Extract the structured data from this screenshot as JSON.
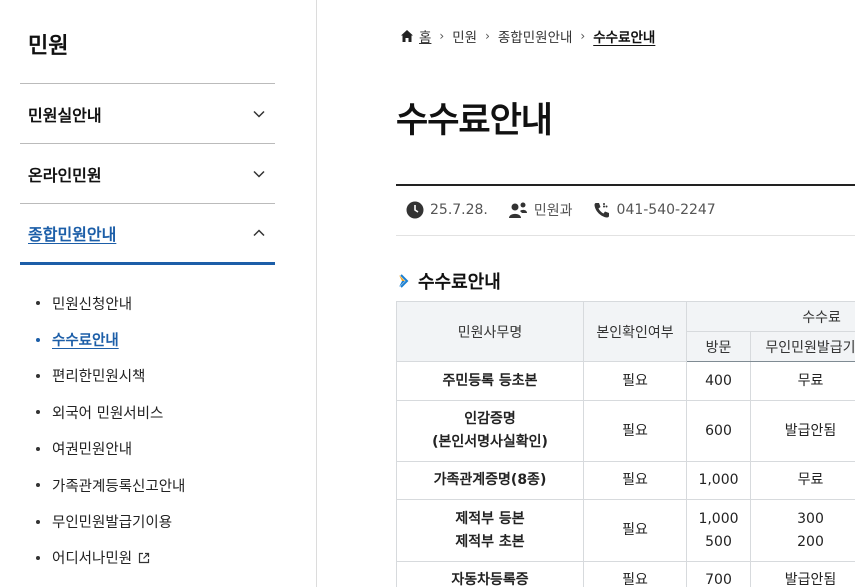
{
  "sidebar": {
    "title": "민원",
    "menu": [
      {
        "label": "민원실안내"
      },
      {
        "label": "온라인민원"
      },
      {
        "label": "종합민원안내"
      }
    ],
    "submenu": [
      {
        "label": "민원신청안내"
      },
      {
        "label": "수수료안내"
      },
      {
        "label": "편리한민원시책"
      },
      {
        "label": "외국어 민원서비스"
      },
      {
        "label": "여권민원안내"
      },
      {
        "label": "가족관계등록신고안내"
      },
      {
        "label": "무인민원발급기이용"
      },
      {
        "label": "어디서나민원"
      }
    ]
  },
  "breadcrumb": [
    "홈",
    "민원",
    "종합민원안내",
    "수수료안내"
  ],
  "page_title": "수수료안내",
  "meta": {
    "date": "25.7.28.",
    "department": "민원과",
    "phone": "041-540-2247"
  },
  "section_title": "수수료안내",
  "table": {
    "headers": {
      "name": "민원사무명",
      "id_check": "본인확인여부",
      "fee": "수수료",
      "visit": "방문",
      "kiosk": "무인민원발급기"
    },
    "rows": [
      {
        "name1": "주민등록 등초본",
        "name2": "",
        "id": "필요",
        "visit1": "400",
        "visit2": "",
        "kiosk1": "무료",
        "kiosk2": ""
      },
      {
        "name1": "인감증명",
        "name2": "(본인서명사실확인)",
        "id": "필요",
        "visit1": "600",
        "visit2": "",
        "kiosk1": "발급안됨",
        "kiosk2": ""
      },
      {
        "name1": "가족관계증명(8종)",
        "name2": "",
        "id": "필요",
        "visit1": "1,000",
        "visit2": "",
        "kiosk1": "무료",
        "kiosk2": ""
      },
      {
        "name1": "제적부 등본",
        "name2": "제적부 초본",
        "id": "필요",
        "visit1": "1,000",
        "visit2": "500",
        "kiosk1": "300",
        "kiosk2": "200"
      },
      {
        "name1": "자동차등록증",
        "name2": "",
        "id": "필요",
        "visit1": "700",
        "visit2": "",
        "kiosk1": "발급안됨",
        "kiosk2": ""
      }
    ]
  }
}
